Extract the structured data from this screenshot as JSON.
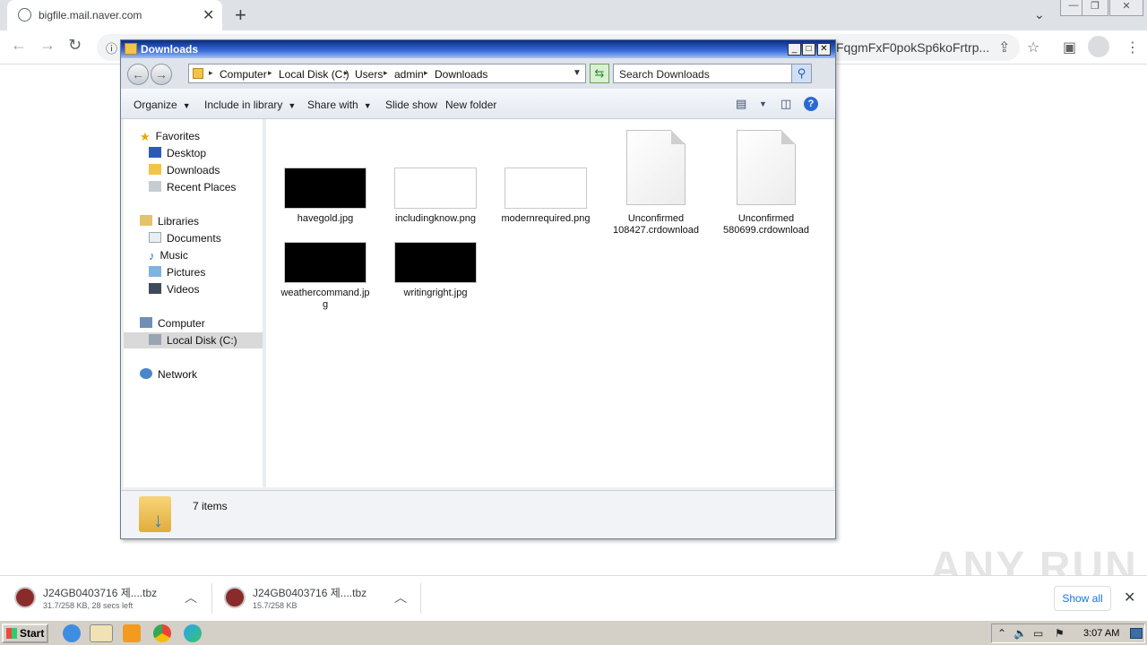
{
  "browser": {
    "tab_title": "bigfile.mail.naver.com",
    "url_tail": "FqgmFxF0pokSp6koFrtrp...",
    "close_tab": "✕",
    "new_tab": "+"
  },
  "explorer": {
    "title": "Downloads",
    "breadcrumb": [
      "Computer",
      "Local Disk (C:)",
      "Users",
      "admin",
      "Downloads"
    ],
    "search_placeholder": "Search Downloads",
    "commands": [
      "Organize",
      "Include in library",
      "Share with",
      "Slide show",
      "New folder"
    ],
    "nav": {
      "favorites_header": "Favorites",
      "favorites": [
        "Desktop",
        "Downloads",
        "Recent Places"
      ],
      "libraries_header": "Libraries",
      "libraries": [
        "Documents",
        "Music",
        "Pictures",
        "Videos"
      ],
      "computer_header": "Computer",
      "computer": [
        "Local Disk (C:)"
      ],
      "network_header": "Network"
    },
    "files": [
      {
        "name": "havegold.jpg",
        "kind": "dark-thumb"
      },
      {
        "name": "includingknow.png",
        "kind": "light-thumb"
      },
      {
        "name": "modernrequired.png",
        "kind": "light-thumb"
      },
      {
        "name": "Unconfirmed 108427.crdownload",
        "kind": "document"
      },
      {
        "name": "Unconfirmed 580699.crdownload",
        "kind": "document"
      },
      {
        "name": "weathercommand.jpg",
        "kind": "dark-thumb"
      },
      {
        "name": "writingright.jpg",
        "kind": "dark-thumb"
      }
    ],
    "status": "7 items"
  },
  "downloads": [
    {
      "name": "J24GB0403716  제....tbz",
      "status": "31.7/258 KB, 28 secs left"
    },
    {
      "name": "J24GB0403716  제....tbz",
      "status": "15.7/258 KB"
    }
  ],
  "shelf": {
    "show_all": "Show all"
  },
  "watermark": "ANY RUN",
  "taskbar": {
    "start": "Start",
    "clock": "3:07 AM"
  }
}
